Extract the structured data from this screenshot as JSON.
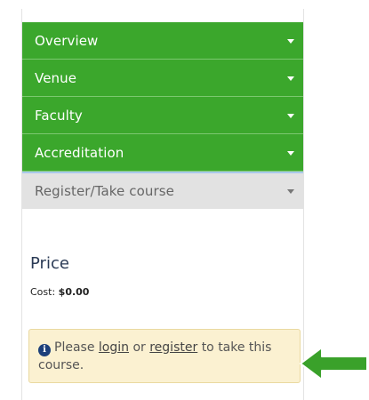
{
  "accordion": {
    "items": [
      {
        "label": "Overview"
      },
      {
        "label": "Venue"
      },
      {
        "label": "Faculty"
      },
      {
        "label": "Accreditation"
      },
      {
        "label": "Register/Take course"
      }
    ]
  },
  "price": {
    "heading": "Price",
    "cost_label": "Cost:",
    "cost_value": "$0.00"
  },
  "notice": {
    "text_before": "Please",
    "login_link": "login",
    "text_middle": "or",
    "register_link": "register",
    "text_after": "to take this course."
  },
  "colors": {
    "accordion_green": "#3ba72c",
    "accordion_grey": "#e2e2e2",
    "notice_bg": "#fbf1d1",
    "arrow_green": "#3aa12a"
  },
  "icons": {
    "caret": "chevron-down-icon",
    "info": "info-icon",
    "pointer": "arrow-left-icon"
  }
}
